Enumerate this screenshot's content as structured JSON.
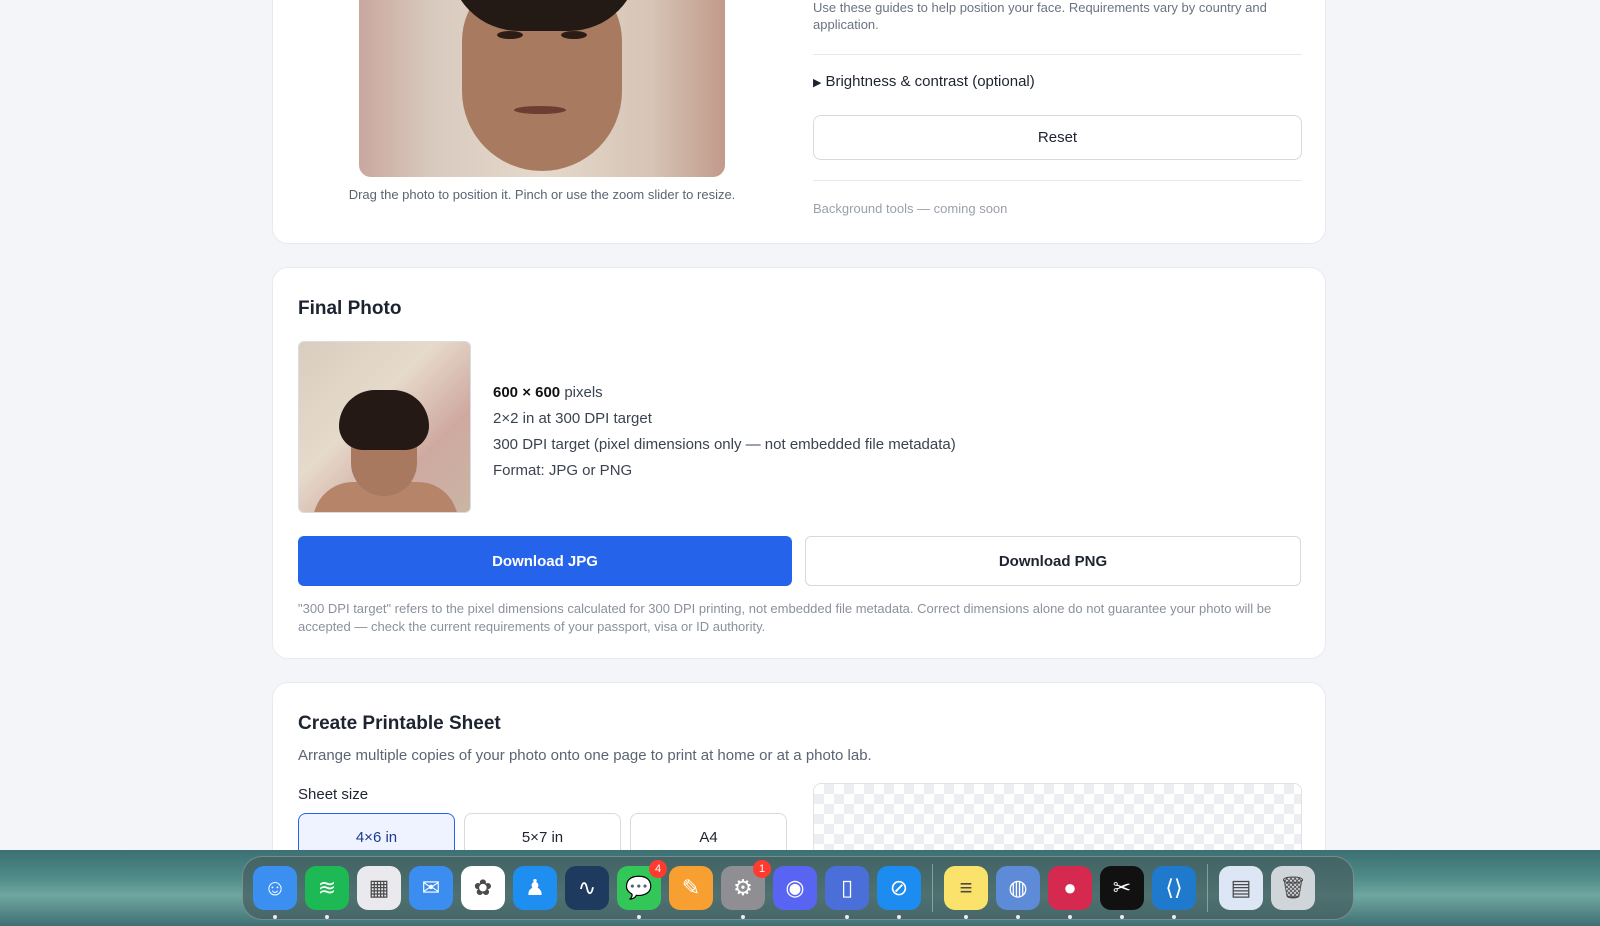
{
  "editor": {
    "photo_hint": "Drag the photo to position it. Pinch or use the zoom slider to resize.",
    "guide_text": "Use these guides to help position your face. Requirements vary by country and application.",
    "brightness_toggle": "Brightness & contrast (optional)",
    "brightness_marker": "▶",
    "reset_label": "Reset",
    "background_tools": "Background tools — coming soon"
  },
  "final_photo": {
    "title": "Final Photo",
    "dimensions": "600 × 600",
    "dimensions_unit": "pixels",
    "size_line": "2×2 in at 300 DPI target",
    "dpi_line": "300 DPI target (pixel dimensions only — not embedded file metadata)",
    "format_line": "Format: JPG or PNG",
    "download_jpg": "Download JPG",
    "download_png": "Download PNG",
    "disclaimer": "\"300 DPI target\" refers to the pixel dimensions calculated for 300 DPI printing, not embedded file metadata. Correct dimensions alone do not guarantee your photo will be accepted — check the current requirements of your passport, visa or ID authority."
  },
  "printable_sheet": {
    "title": "Create Printable Sheet",
    "subtitle": "Arrange multiple copies of your photo onto one page to print at home or at a photo lab.",
    "sheet_size_label": "Sheet size",
    "sizes": [
      "4×6 in",
      "5×7 in",
      "A4"
    ],
    "selected_size": "4×6 in"
  },
  "dock": {
    "apps": [
      {
        "name": "finder-icon",
        "color": "#3b8ff0",
        "glyph": "☺",
        "running": true
      },
      {
        "name": "spotify-icon",
        "color": "#1db954",
        "glyph": "≋",
        "running": true
      },
      {
        "name": "launchpad-icon",
        "color": "#e9e9ee",
        "glyph": "▦",
        "running": false
      },
      {
        "name": "mail-icon",
        "color": "#3c8df0",
        "glyph": "✉",
        "running": false
      },
      {
        "name": "photos-icon",
        "color": "#ffffff",
        "glyph": "✿",
        "running": false
      },
      {
        "name": "keynote-icon",
        "color": "#1f8ef1",
        "glyph": "♟",
        "running": false
      },
      {
        "name": "freeform-icon",
        "color": "#1e3a5f",
        "glyph": "∿",
        "running": false
      },
      {
        "name": "messages-icon",
        "color": "#33c75a",
        "glyph": "💬",
        "running": true,
        "badge": "4"
      },
      {
        "name": "pages-icon",
        "color": "#f7a031",
        "glyph": "✎",
        "running": false
      },
      {
        "name": "system-settings-icon",
        "color": "#8e8e93",
        "glyph": "⚙",
        "running": true,
        "badge": "1"
      },
      {
        "name": "discord-icon",
        "color": "#5865f2",
        "glyph": "◉",
        "running": false
      },
      {
        "name": "simulator-icon",
        "color": "#4a6fd9",
        "glyph": "▯",
        "running": true
      },
      {
        "name": "safari-icon",
        "color": "#1d8cf0",
        "glyph": "⊘",
        "running": true
      },
      {
        "name": "notes-icon",
        "color": "#fbe26a",
        "glyph": "≡",
        "running": true
      },
      {
        "name": "backup-icon",
        "color": "#5d8bd8",
        "glyph": "◍",
        "running": true
      },
      {
        "name": "screen-recorder-icon",
        "color": "#d6294f",
        "glyph": "●",
        "running": true
      },
      {
        "name": "capcut-icon",
        "color": "#111111",
        "glyph": "✂",
        "running": true
      },
      {
        "name": "vscode-icon",
        "color": "#1f7acd",
        "glyph": "⟨⟩",
        "running": true
      }
    ],
    "extras": [
      {
        "name": "downloads-stack-icon",
        "color": "#dce6f5",
        "glyph": "▤"
      },
      {
        "name": "trash-icon",
        "color": "#d0d5da",
        "glyph": "🗑"
      }
    ]
  }
}
